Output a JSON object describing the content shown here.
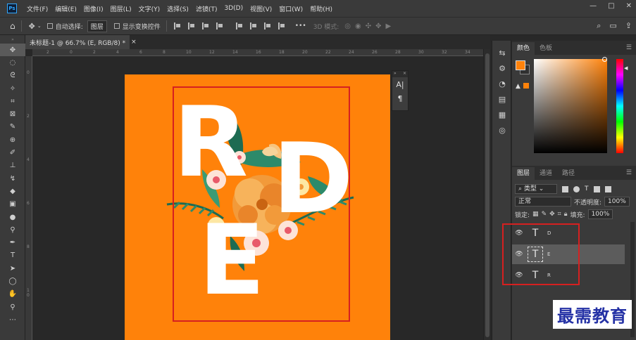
{
  "app": {
    "logo": "Ps"
  },
  "menu": [
    "文件(F)",
    "编辑(E)",
    "图像(I)",
    "图层(L)",
    "文字(Y)",
    "选择(S)",
    "滤镜(T)",
    "3D(D)",
    "视图(V)",
    "窗口(W)",
    "帮助(H)"
  ],
  "window_controls": {
    "minimize": "—",
    "restore": "□",
    "close": "✕"
  },
  "options": {
    "auto_select_label": "自动选择:",
    "auto_select_value": "图层",
    "show_transform_label": "显示变换控件",
    "more": "•••",
    "mode_3d_label": "3D 模式:"
  },
  "document": {
    "tab_title": "未标题-1 @ 66.7% (E, RGB/8) *",
    "close": "×"
  },
  "ruler_top_labels": [
    "2",
    "0",
    "2",
    "4",
    "6",
    "8",
    "10",
    "12",
    "14",
    "16",
    "18",
    "20",
    "22",
    "24",
    "26",
    "28",
    "30",
    "32",
    "34"
  ],
  "ruler_left_labels": [
    "0",
    "2",
    "4",
    "6",
    "8",
    "1\n0"
  ],
  "canvas": {
    "letters": {
      "r": "R",
      "d": "D",
      "e": "E"
    },
    "artboard_color": "#ff820a",
    "selection_color": "#d62020"
  },
  "char_panel": {
    "collapse": "»",
    "close": "×",
    "items": [
      "A|",
      "¶"
    ]
  },
  "color_panel": {
    "tabs": [
      "颜色",
      "色板"
    ],
    "foreground": "#ff820a",
    "warning": "▲"
  },
  "layers_panel": {
    "tabs": [
      "图层",
      "通道",
      "路径"
    ],
    "filter_label": "类型",
    "blend_mode": "正常",
    "opacity_label": "不透明度:",
    "opacity_value": "100%",
    "lock_label": "锁定:",
    "fill_label": "填充:",
    "fill_value": "100%",
    "layers": [
      {
        "thumb": "T",
        "name": "D",
        "selected": false
      },
      {
        "thumb": "T",
        "name": "E",
        "selected": true
      },
      {
        "thumb": "T",
        "name": "R",
        "selected": false
      }
    ]
  },
  "watermark": "最需教育"
}
